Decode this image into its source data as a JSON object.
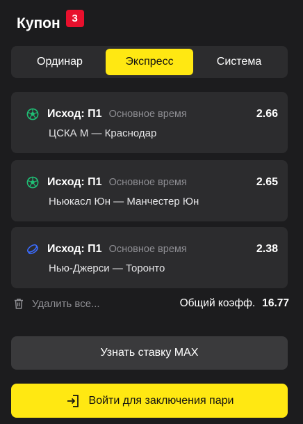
{
  "header": {
    "title": "Купон",
    "badge_count": "3"
  },
  "tabs": [
    {
      "label": "Ординар",
      "active": false
    },
    {
      "label": "Экспресс",
      "active": true
    },
    {
      "label": "Система",
      "active": false
    }
  ],
  "bets": [
    {
      "sport_icon": "football-icon",
      "outcome": "Исход: П1",
      "period": "Основное время",
      "odds": "2.66",
      "match": "ЦСКА М — Краснодар"
    },
    {
      "sport_icon": "football-icon",
      "outcome": "Исход: П1",
      "period": "Основное время",
      "odds": "2.65",
      "match": "Ньюкасл Юн — Манчестер Юн"
    },
    {
      "sport_icon": "hockey-puck-icon",
      "outcome": "Исход: П1",
      "period": "Основное время",
      "odds": "2.38",
      "match": "Нью-Джерси — Торонто"
    }
  ],
  "footer": {
    "delete_all": "Удалить все...",
    "total_label": "Общий коэфф.",
    "total_value": "16.77"
  },
  "buttons": {
    "max_stake": "Узнать ставку MAX",
    "login": "Войти для заключения пари"
  },
  "colors": {
    "background": "#1c1c1e",
    "card": "#2c2c2e",
    "accent_yellow": "#ffe812",
    "badge_red": "#e8102d",
    "football_green": "#1fbf75",
    "hockey_blue": "#3b6cff",
    "muted_text": "#8e8e93"
  }
}
